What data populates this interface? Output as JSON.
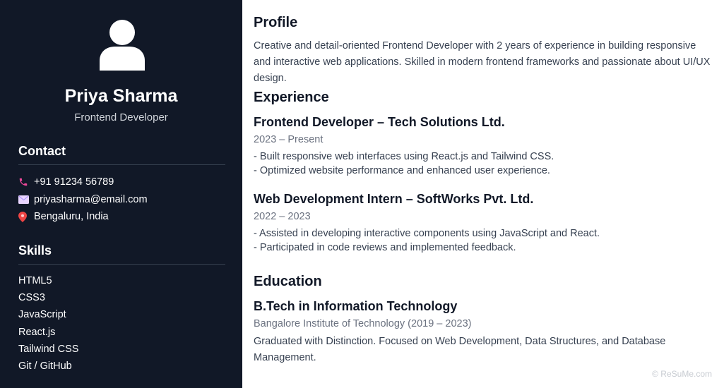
{
  "sidebar": {
    "name": "Priya Sharma",
    "role": "Frontend Developer",
    "contact_heading": "Contact",
    "contact": [
      {
        "icon": "phone-icon",
        "text": "+91 91234 56789"
      },
      {
        "icon": "envelope-icon",
        "text": "priyasharma@email.com"
      },
      {
        "icon": "location-pin-icon",
        "text": "Bengaluru, India"
      }
    ],
    "skills_heading": "Skills",
    "skills": [
      "HTML5",
      "CSS3",
      "JavaScript",
      "React.js",
      "Tailwind CSS",
      "Git / GitHub"
    ]
  },
  "profile": {
    "heading": "Profile",
    "text": "Creative and detail-oriented Frontend Developer with 2 years of experience in building responsive and interactive web applications. Skilled in modern frontend frameworks and passionate about UI/UX design."
  },
  "experience": {
    "heading": "Experience",
    "jobs": [
      {
        "title": "Frontend Developer – Tech Solutions Ltd.",
        "dates": "2023 – Present",
        "bullets": [
          "- Built responsive web interfaces using React.js and Tailwind CSS.",
          "- Optimized website performance and enhanced user experience."
        ]
      },
      {
        "title": "Web Development Intern – SoftWorks Pvt. Ltd.",
        "dates": "2022 – 2023",
        "bullets": [
          "- Assisted in developing interactive components using JavaScript and React.",
          "- Participated in code reviews and implemented feedback."
        ]
      }
    ]
  },
  "education": {
    "heading": "Education",
    "degree": "B.Tech in Information Technology",
    "school": "Bangalore Institute of Technology (2019 – 2023)",
    "note": "Graduated with Distinction. Focused on Web Development, Data Structures, and Database Management."
  },
  "footer": "© ReSuMe.com",
  "colors": {
    "sidebar_bg": "#111827",
    "phone_icon": "#ec4899",
    "pin_icon": "#ef4444"
  }
}
